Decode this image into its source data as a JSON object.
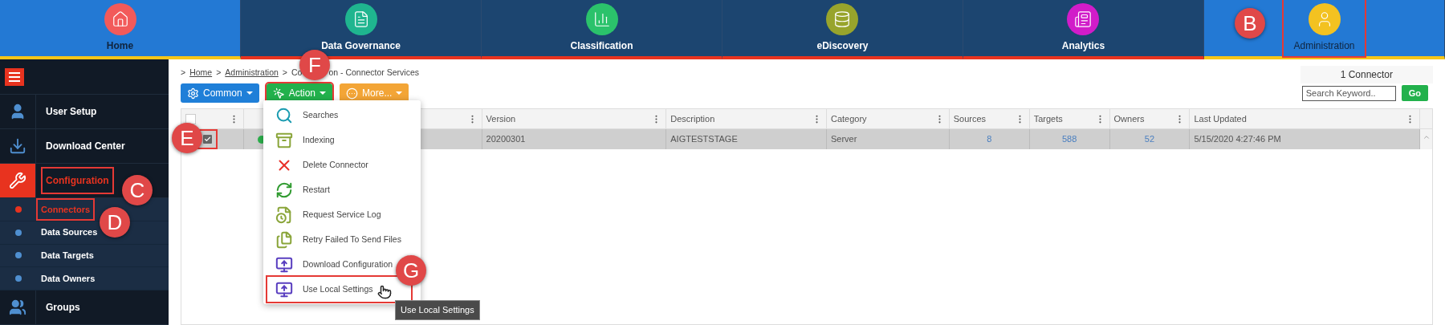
{
  "nav_tabs": [
    {
      "label": "Home",
      "color": "#f25a5a",
      "selected": false,
      "kind": "home",
      "highlighted": false
    },
    {
      "label": "Data Governance",
      "color": "#1fb58f",
      "selected": false,
      "kind": "module",
      "highlighted": false
    },
    {
      "label": "Classification",
      "color": "#2bc26b",
      "selected": false,
      "kind": "module",
      "highlighted": false
    },
    {
      "label": "eDiscovery",
      "color": "#98a42c",
      "selected": false,
      "kind": "module",
      "highlighted": false
    },
    {
      "label": "Analytics",
      "color": "#d11cc9",
      "selected": false,
      "kind": "module",
      "highlighted": false
    },
    {
      "label": "Administration",
      "color": "#f3c221",
      "selected": true,
      "kind": "module",
      "highlighted": true
    }
  ],
  "sidebar": {
    "items": [
      {
        "label": "User Setup",
        "selected": false,
        "highlighted": false
      },
      {
        "label": "Download Center",
        "selected": false,
        "highlighted": false
      },
      {
        "label": "Configuration",
        "selected": true,
        "highlighted": true,
        "children": [
          {
            "label": "Connectors",
            "selected": true,
            "highlighted": true
          },
          {
            "label": "Data Sources",
            "selected": false,
            "highlighted": false
          },
          {
            "label": "Data Targets",
            "selected": false,
            "highlighted": false
          },
          {
            "label": "Data Owners",
            "selected": false,
            "highlighted": false
          }
        ]
      },
      {
        "label": "Groups",
        "selected": false,
        "highlighted": false
      }
    ]
  },
  "breadcrumb": [
    {
      "text": ">",
      "kind": "separator"
    },
    {
      "text": "Home",
      "kind": "link"
    },
    {
      "text": ">",
      "kind": "separator"
    },
    {
      "text": "Administration",
      "kind": "link"
    },
    {
      "text": ">",
      "kind": "separator"
    },
    {
      "text": "Co",
      "kind": "text"
    },
    {
      "text": "on - Connector Services",
      "kind": "text"
    }
  ],
  "toolbar": [
    {
      "label": "Common",
      "highlighted": false
    },
    {
      "label": "Action",
      "highlighted": true
    },
    {
      "label": "More...",
      "highlighted": false
    }
  ],
  "count": "1 Connector",
  "search": {
    "placeholder": "Search Keyword..",
    "button": "Go"
  },
  "table": {
    "select_all_checked": false,
    "columns": [
      "",
      "",
      "",
      "Version",
      "Description",
      "Category",
      "Sources",
      "Targets",
      "Owners",
      "Last Updated"
    ],
    "rows": [
      {
        "checked": true,
        "highlighted": true,
        "selected": true,
        "cells": [
          "",
          "",
          "",
          "20200301",
          "AIGTESTSTAGE",
          "Server",
          "8",
          "588",
          "52",
          "5/15/2020 4:27:46 PM"
        ]
      }
    ]
  },
  "action_menu": {
    "items": [
      {
        "label": "Searches",
        "highlighted": false
      },
      {
        "label": "Indexing",
        "highlighted": false
      },
      {
        "label": "Delete Connector",
        "highlighted": false
      },
      {
        "label": "Restart",
        "highlighted": false
      },
      {
        "label": "Request Service Log",
        "highlighted": false
      },
      {
        "label": "Retry Failed To Send Files",
        "highlighted": false
      },
      {
        "label": "Download Configuration",
        "highlighted": false
      },
      {
        "label": "Use Local Settings",
        "highlighted": true
      }
    ]
  },
  "tooltip": "Use Local Settings",
  "markers": [
    "B",
    "C",
    "D",
    "E",
    "F",
    "G"
  ]
}
